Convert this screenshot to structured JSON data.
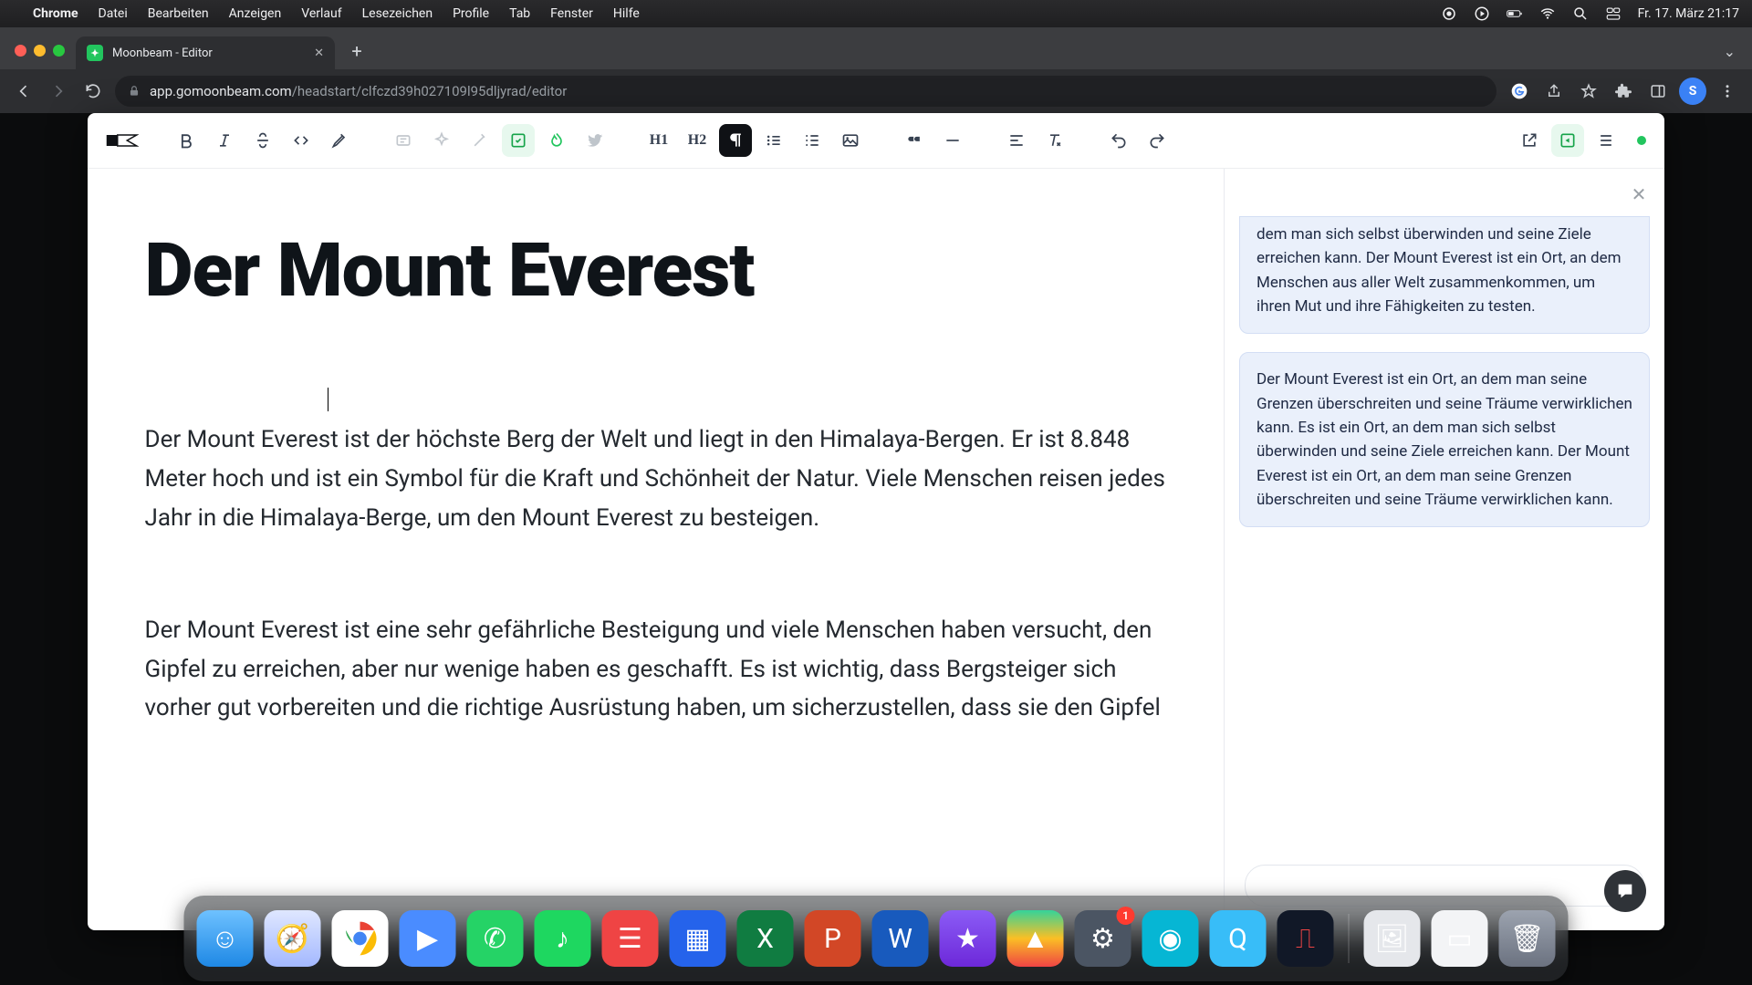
{
  "menubar": {
    "app": "Chrome",
    "items": [
      "Datei",
      "Bearbeiten",
      "Anzeigen",
      "Verlauf",
      "Lesezeichen",
      "Profile",
      "Tab",
      "Fenster",
      "Hilfe"
    ],
    "clock": "Fr. 17. März 21:17"
  },
  "browser": {
    "tab_title": "Moonbeam - Editor",
    "url_host": "app.gomoonbeam.com",
    "url_path": "/headstart/clfczd39h027109l95dljyrad/editor",
    "avatar_letter": "S"
  },
  "toolbar": {
    "h1": "H1",
    "h2": "H2"
  },
  "document": {
    "title": "Der Mount Everest",
    "p1": "Der Mount Everest ist der höchste Berg der Welt und liegt in den Himalaya-Bergen. Er ist 8.848 Meter hoch und ist ein Symbol für die Kraft und Schönheit der Natur. Viele Menschen reisen jedes Jahr in die Himalaya-Berge, um den Mount Everest zu besteigen.",
    "p2": "Der Mount Everest ist eine sehr gefährliche Besteigung und viele Menschen haben versucht, den Gipfel zu erreichen, aber nur wenige haben es geschafft. Es ist wichtig, dass Bergsteiger sich vorher gut vorbereiten und die richtige Ausrüstung haben, um sicherzustellen, dass sie den Gipfel"
  },
  "suggestions": {
    "s1": "dem man sich selbst überwinden und seine Ziele erreichen kann. Der Mount Everest ist ein Ort, an dem Menschen aus aller Welt zusammenkommen, um ihren Mut und ihre Fähigkeiten zu testen.",
    "s2": "Der Mount Everest ist ein Ort, an dem man seine Grenzen überschreiten und seine Träume verwirklichen kann. Es ist ein Ort, an dem man sich selbst überwinden und seine Ziele erreichen kann. Der Mount Everest ist ein Ort, an dem man seine Grenzen überschreiten und seine Träume verwirklichen kann."
  },
  "chat": {
    "placeholder": ""
  },
  "dock": {
    "settings_badge": "1"
  }
}
